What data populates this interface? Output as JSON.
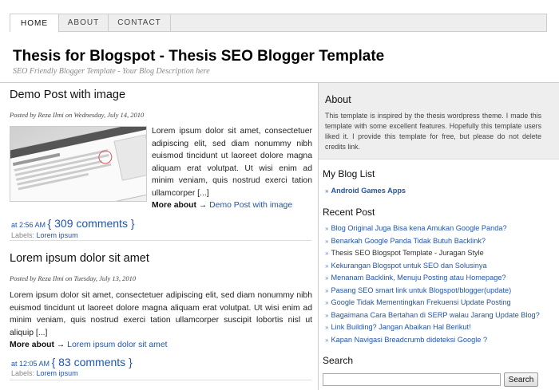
{
  "nav": {
    "items": [
      "HOME",
      "ABOUT",
      "CONTACT"
    ]
  },
  "header": {
    "title": "Thesis for Blogspot - Thesis SEO Blogger Template",
    "description": "SEO Friendly Blogger Template - Your Blog Description here"
  },
  "posts": [
    {
      "title": "Demo Post with image",
      "byline": "Posted by Reza Ilmi on Wednesday, July 14, 2010",
      "body": "Lorem ipsum dolor sit amet, consectetuer adipiscing elit, sed diam nonummy nibh euismod tincidunt ut laoreet dolore magna aliquam erat volutpat. Ut wisi enim ad minim veniam, quis nostrud exerci tation ullamcorper [...]",
      "more_label": "More about",
      "arrow": "→",
      "more_link": "Demo Post with image",
      "time": "at 2:56 AM",
      "comments": "309 comments",
      "labels_prefix": "Labels:",
      "label": "Lorem ipsum"
    },
    {
      "title": "Lorem ipsum dolor sit amet",
      "byline": "Posted by Reza Ilmi on Tuesday, July 13, 2010",
      "body": "Lorem ipsum dolor sit amet, consectetuer adipiscing elit, sed diam nonummy nibh euismod tincidunt ut laoreet dolore magna aliquam erat volutpat. Ut wisi enim ad minim veniam, quis nostrud exerci tation ullamcorper suscipit lobortis nisl ut aliquip [...]",
      "more_label": "More about",
      "arrow": "→",
      "more_link": "Lorem ipsum dolor sit amet",
      "time": "at 12:05 AM",
      "comments": "83 comments",
      "labels_prefix": "Labels:",
      "label": "Lorem ipsum"
    }
  ],
  "sidebar": {
    "about_title": "About",
    "about_text": "This template is inspired by the thesis wordpress theme. I made this template with some excellent features. Hopefully this template users liked it. I provide this template for free, but please do not delete credits link.",
    "bloglist_title": "My Blog List",
    "bloglist": [
      "Android Games Apps"
    ],
    "recent_title": "Recent Post",
    "recent": [
      "Blog Original Juga Bisa kena Amukan Google Panda?",
      "Benarkah Google Panda Tidak Butuh Backlink?",
      "Thesis SEO Blogspot Template - Juragan Style",
      "Kekurangan Blogspot untuk SEO dan Solusinya",
      "Menanam Backlink, Menuju Posting atau Homepage?",
      "Pasang SEO smart link untuk Blogspot/blogger(update)",
      "Google Tidak Mementingkan Frekuensi Update Posting",
      "Bagaimana Cara Bertahan di SERP walau Jarang Update Blog?",
      "Link Building? Jangan Abaikan Hal Berikut!",
      "Kapan Navigasi Breadcrumb dideteksi Google ?"
    ],
    "search_title": "Search",
    "search_button": "Search",
    "search_value": ""
  },
  "colors": {
    "link": "#2255aa",
    "nav_bg": "#eeeeee",
    "about_bg": "#eeeeee"
  }
}
